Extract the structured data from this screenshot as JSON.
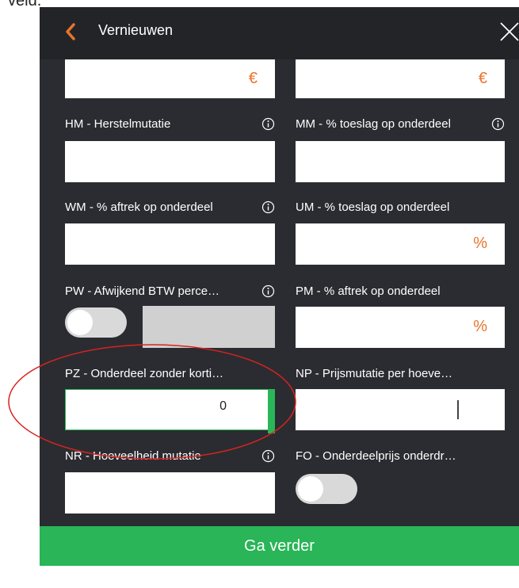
{
  "top_text": "veld.",
  "header": {
    "title": "Vernieuwen"
  },
  "fields": {
    "row0": {
      "left_suffix": "€",
      "right_suffix": "€"
    },
    "hm": {
      "label": "HM - Herstelmutatie"
    },
    "mm": {
      "label": "MM - % toeslag op onderdeel"
    },
    "wm": {
      "label": "WM - % aftrek op onderdeel"
    },
    "um": {
      "label": "UM - % toeslag op onderdeel",
      "suffix": "%"
    },
    "pw": {
      "label": "PW - Afwijkend BTW perce…"
    },
    "pm": {
      "label": "PM - % aftrek op onderdeel",
      "suffix": "%"
    },
    "pz": {
      "label": "PZ - Onderdeel zonder korti…",
      "value": "0"
    },
    "np": {
      "label": "NP - Prijsmutatie per hoeve…"
    },
    "nr": {
      "label": "NR - Hoeveelheid mutatie"
    },
    "fo": {
      "label": "FO - Onderdeelprijs onderdr…"
    }
  },
  "footer": {
    "button_label": "Ga verder"
  },
  "colors": {
    "accent": "#e8742c",
    "green": "#29b558",
    "panel": "#2b2c31",
    "annotation": "#d9231f"
  }
}
